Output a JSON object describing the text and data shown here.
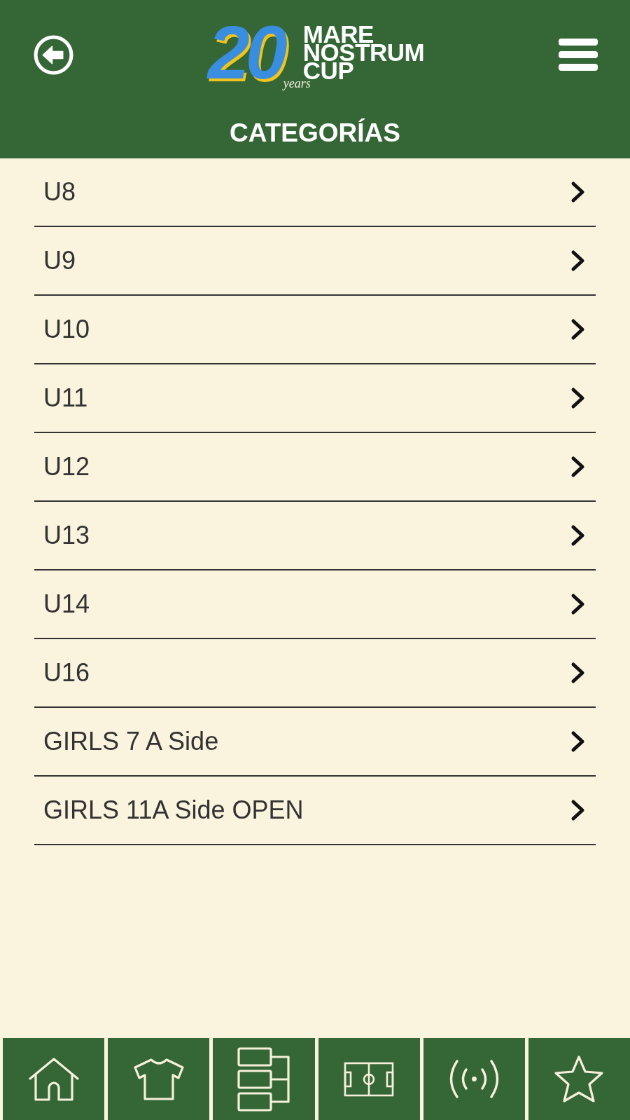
{
  "header": {
    "logo": {
      "number": "20",
      "tagline": "years",
      "wordmark": "MARE NOSTRUM CUP"
    },
    "title": "CATEGORÍAS"
  },
  "categories": [
    "U8",
    "U9",
    "U10",
    "U11",
    "U12",
    "U13",
    "U14",
    "U16",
    "GIRLS 7 A Side",
    "GIRLS 11A Side OPEN"
  ]
}
